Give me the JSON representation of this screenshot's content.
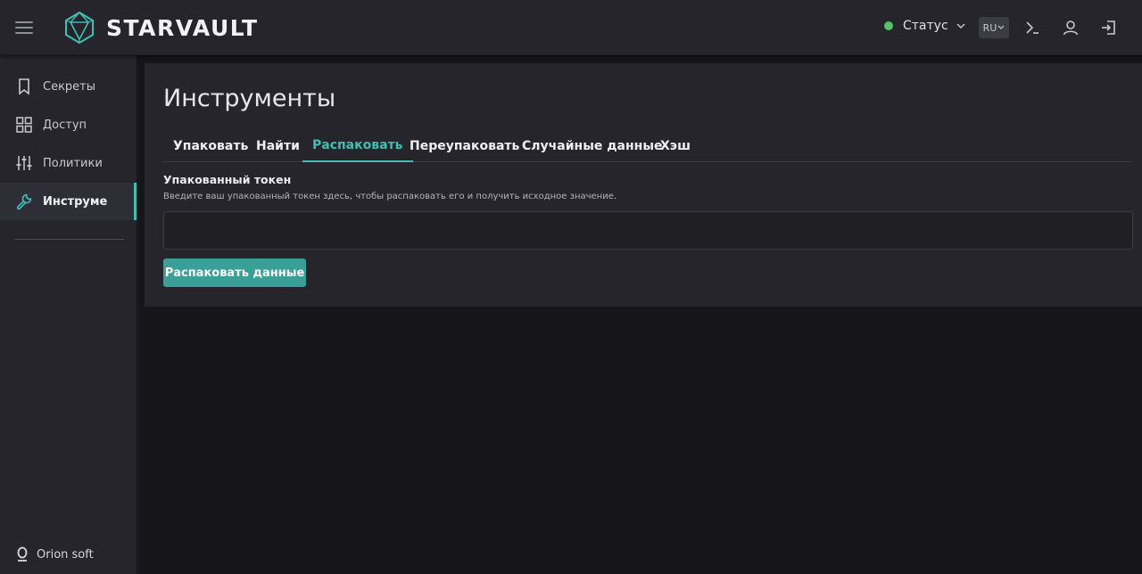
{
  "header": {
    "menu_icon": "hamburger-menu-icon",
    "logo_text": "STARVAULT",
    "status_label": "Статус",
    "status_color": "#55c26a",
    "language": "RU",
    "icons": [
      "terminal-icon",
      "user-icon",
      "logout-icon"
    ]
  },
  "sidebar": {
    "items": [
      {
        "label": "Секреты",
        "icon": "bookmark-icon"
      },
      {
        "label": "Доступ",
        "icon": "grid-icon"
      },
      {
        "label": "Политики",
        "icon": "sliders-icon"
      },
      {
        "label": "Инструменты",
        "icon": "wrench-icon",
        "active": true
      }
    ],
    "footer_brand": "Orion soft"
  },
  "main": {
    "title": "Инструменты",
    "tabs": [
      {
        "label": "Упаковать"
      },
      {
        "label": "Найти"
      },
      {
        "label": "Распаковать",
        "active": true
      },
      {
        "label": "Переупаковать"
      },
      {
        "label": "Случайные данные"
      },
      {
        "label": "Хэш"
      }
    ],
    "field_label": "Упакованный токен",
    "field_help": "Введите ваш упакованный токен здесь, чтобы распаковать его и получить исходное значение.",
    "field_value": "",
    "button_label": "Распаковать данные"
  },
  "colors": {
    "accent": "#3fbfb3",
    "button": "#3a9f97",
    "background": "#161619",
    "surface": "#25252b"
  }
}
